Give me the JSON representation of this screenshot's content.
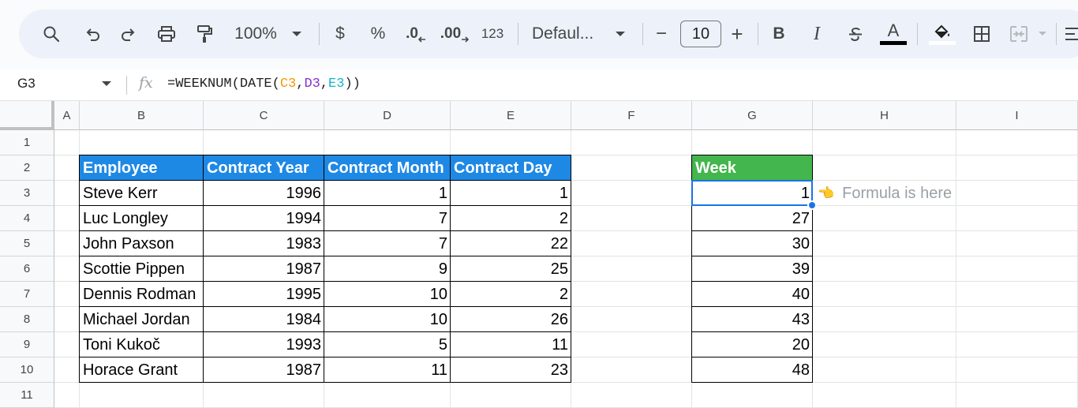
{
  "toolbar": {
    "zoom": "100%",
    "currency": "$",
    "percent": "%",
    "decrease_decimal": ".0",
    "increase_decimal": ".00",
    "number_format": "123",
    "font": "Defaul...",
    "font_size": "10",
    "minus": "−",
    "plus": "+",
    "bold": "B",
    "italic": "I",
    "text_color_letter": "A"
  },
  "formula_bar": {
    "cell_ref": "G3",
    "fx": "fx",
    "formula_prefix": "=WEEKNUM(DATE(",
    "ref_c": "C3",
    "comma1": ",",
    "ref_d": "D3",
    "comma2": ",",
    "ref_e": "E3",
    "formula_suffix": "))"
  },
  "columns": [
    "A",
    "B",
    "C",
    "D",
    "E",
    "F",
    "G",
    "H",
    "I"
  ],
  "rows": [
    "1",
    "2",
    "3",
    "4",
    "5",
    "6",
    "7",
    "8",
    "9",
    "10",
    "11"
  ],
  "table": {
    "headers": [
      "Employee",
      "Contract Year",
      "Contract Month",
      "Contract Day"
    ],
    "rows": [
      [
        "Steve Kerr",
        "1996",
        "1",
        "1"
      ],
      [
        "Luc Longley",
        "1994",
        "7",
        "2"
      ],
      [
        "John Paxson",
        "1983",
        "7",
        "22"
      ],
      [
        "Scottie Pippen",
        "1987",
        "9",
        "25"
      ],
      [
        "Dennis Rodman",
        "1995",
        "10",
        "2"
      ],
      [
        "Michael Jordan",
        "1984",
        "10",
        "26"
      ],
      [
        "Toni Kukoč",
        "1993",
        "5",
        "11"
      ],
      [
        "Horace Grant",
        "1987",
        "11",
        "23"
      ]
    ]
  },
  "week": {
    "header": "Week",
    "values": [
      "1",
      "27",
      "30",
      "39",
      "40",
      "43",
      "20",
      "48"
    ]
  },
  "note": {
    "icon": "👈",
    "text": "Formula is here"
  },
  "colors": {
    "header_blue": "#1e88e5",
    "header_green": "#43b64d",
    "selection": "#1a73e8"
  }
}
